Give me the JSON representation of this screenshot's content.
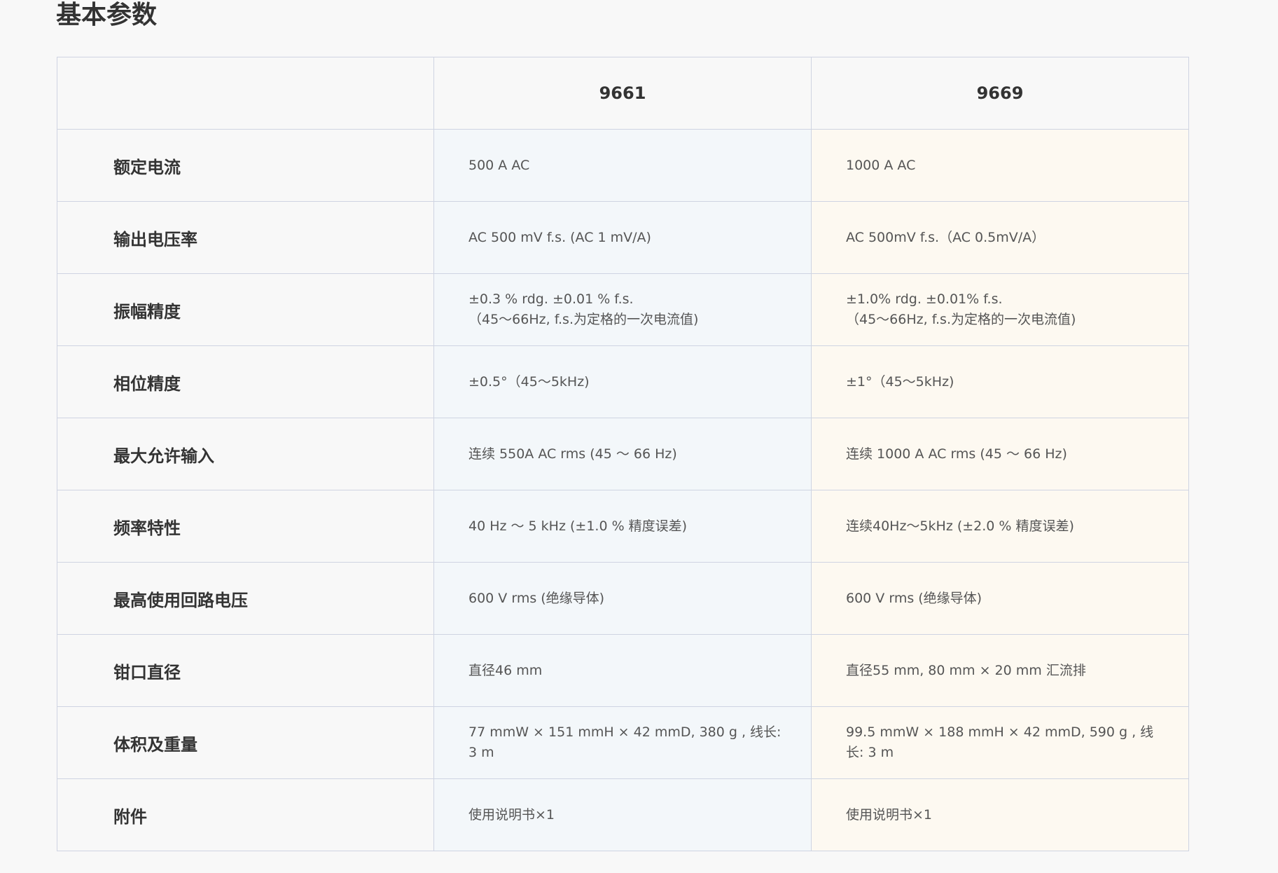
{
  "title": "基本参数",
  "table": {
    "headers": [
      "",
      "9661",
      "9669"
    ],
    "rows": [
      {
        "label": "额定电流",
        "v1": "500 A AC",
        "v2": "1000 A AC"
      },
      {
        "label": "输出电压率",
        "v1": "AC 500 mV f.s. (AC 1 mV/A)",
        "v2": "AC 500mV f.s.（AC 0.5mV/A）"
      },
      {
        "label": "振幅精度",
        "v1": "±0.3 % rdg. ±0.01 % f.s.\n（45～66Hz, f.s.为定格的一次电流值)",
        "v2": "±1.0% rdg. ±0.01% f.s.\n（45～66Hz, f.s.为定格的一次电流值)"
      },
      {
        "label": "相位精度",
        "v1": "±0.5°（45～5kHz)",
        "v2": "±1°（45～5kHz)"
      },
      {
        "label": "最大允许输入",
        "v1": "连续 550A AC rms (45 ～ 66 Hz)",
        "v2": "连续 1000 A AC rms (45 ～ 66 Hz)"
      },
      {
        "label": "频率特性",
        "v1": "40 Hz ～ 5 kHz (±1.0 % 精度误差)",
        "v2": "连续40Hz～5kHz (±2.0 % 精度误差)"
      },
      {
        "label": "最高使用回路电压",
        "v1": "600 V rms (绝缘导体)",
        "v2": "600 V rms (绝缘导体)"
      },
      {
        "label": "钳口直径",
        "v1": "直径46 mm",
        "v2": "直径55 mm, 80 mm × 20 mm 汇流排"
      },
      {
        "label": "体积及重量",
        "v1": "77 mmW × 151 mmH × 42 mmD, 380 g , 线长: 3 m",
        "v2": "99.5 mmW × 188 mmH × 42 mmD, 590 g , 线长: 3 m"
      },
      {
        "label": "附件",
        "v1": "使用说明书×1",
        "v2": "使用说明书×1"
      }
    ]
  }
}
